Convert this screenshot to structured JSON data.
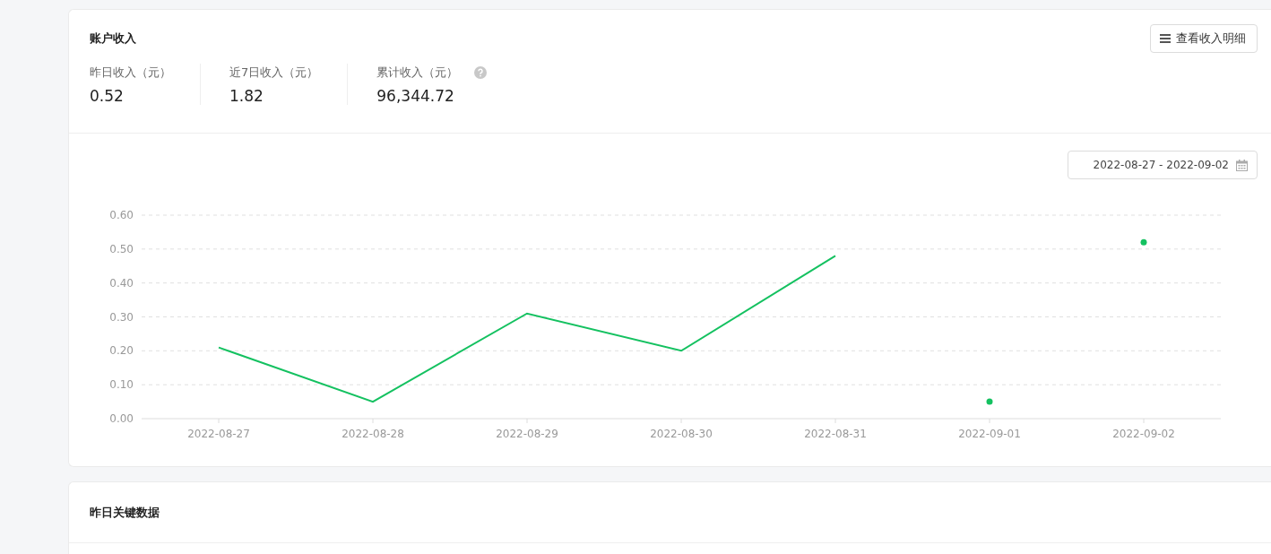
{
  "income_card": {
    "title": "账户收入",
    "detail_button": "查看收入明细",
    "stats": [
      {
        "label": "昨日收入（元）",
        "value": "0.52",
        "help": false
      },
      {
        "label": "近7日收入（元）",
        "value": "1.82",
        "help": false
      },
      {
        "label": "累计收入（元）",
        "value": "96,344.72",
        "help": true
      }
    ],
    "date_range": "2022-08-27 - 2022-09-02",
    "chart_data": {
      "type": "line",
      "categories": [
        "2022-08-27",
        "2022-08-28",
        "2022-08-29",
        "2022-08-30",
        "2022-08-31",
        "2022-09-01",
        "2022-09-02"
      ],
      "series": [
        {
          "color": "#14c160",
          "values": [
            0.21,
            0.05,
            0.31,
            0.2,
            0.48,
            null,
            null
          ]
        },
        {
          "color": "#14c160",
          "marker": true,
          "values": [
            null,
            null,
            null,
            null,
            null,
            0.05,
            null
          ]
        },
        {
          "color": "#14c160",
          "marker": true,
          "values": [
            null,
            null,
            null,
            null,
            null,
            null,
            0.52
          ]
        }
      ],
      "grid": true,
      "ylim": [
        0,
        0.6
      ],
      "yticks": [
        {
          "value": 0,
          "label": "0.00"
        },
        {
          "value": 0.1,
          "label": "0.10"
        },
        {
          "value": 0.2,
          "label": "0.20"
        },
        {
          "value": 0.3,
          "label": "0.30"
        },
        {
          "value": 0.4,
          "label": "0.40"
        },
        {
          "value": 0.5,
          "label": "0.50"
        },
        {
          "value": 0.6,
          "label": "0.60"
        }
      ]
    }
  },
  "key_data_card": {
    "title": "昨日关键数据"
  }
}
